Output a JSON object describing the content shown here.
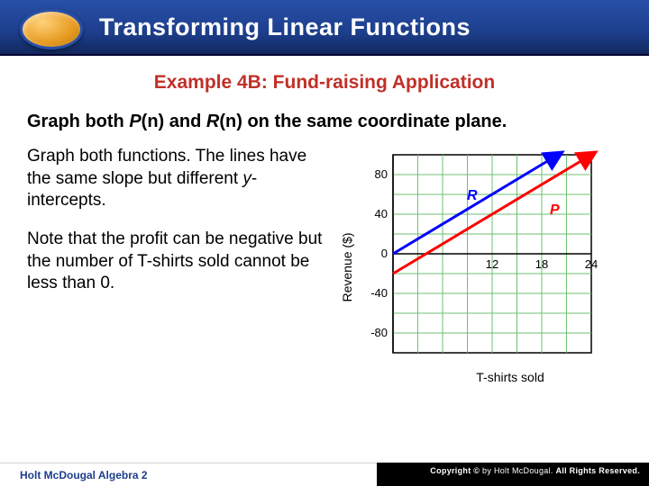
{
  "title": "Transforming Linear Functions",
  "subtitle": "Example 4B: Fund-raising Application",
  "prompt_parts": {
    "lead": "Graph both ",
    "p": "P",
    "n1": "(n)",
    "and": " and ",
    "r": "R",
    "n2": "(n)",
    "tail": " on the same coordinate plane."
  },
  "para1_parts": {
    "a": "Graph both functions. The lines have the same slope but different ",
    "y": "y",
    "b": "-intercepts."
  },
  "para2": "Note that the profit can be negative but the number of T-shirts sold cannot be less than 0.",
  "footer_left": "Holt McDougal Algebra 2",
  "footer_right": "Copyright © by Holt McDougal. All Rights Reserved.",
  "chart_data": {
    "type": "line",
    "xlabel": "T-shirts sold",
    "ylabel": "Revenue ($)",
    "xlim": [
      0,
      24
    ],
    "ylim": [
      -100,
      100
    ],
    "x_ticks": [
      12,
      18,
      24
    ],
    "y_ticks": [
      -80,
      -40,
      0,
      40,
      80
    ],
    "grid": true,
    "series": [
      {
        "name": "R",
        "color": "#0000ff",
        "points": [
          [
            0,
            0
          ],
          [
            20,
            100
          ]
        ]
      },
      {
        "name": "P",
        "color": "#ff0000",
        "points": [
          [
            0,
            -20
          ],
          [
            24,
            100
          ]
        ]
      }
    ],
    "legend_positions": {
      "R": [
        9,
        60
      ],
      "P": [
        19,
        44
      ]
    }
  }
}
